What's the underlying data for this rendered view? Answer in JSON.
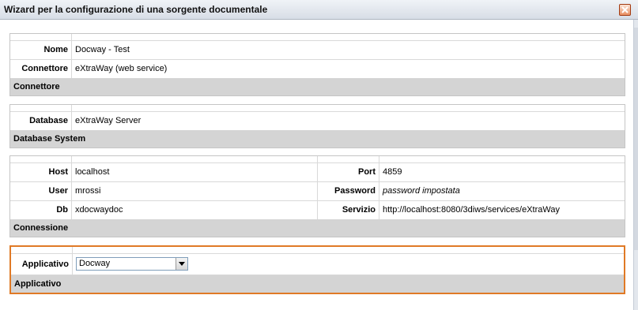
{
  "window": {
    "title": "Wizard per la configurazione di una sorgente documentale"
  },
  "connettore_section": {
    "footer": "Connettore",
    "rows": [
      {
        "label": "Nome",
        "value": "Docway - Test"
      },
      {
        "label": "Connettore",
        "value": "eXtraWay (web service)"
      }
    ]
  },
  "database_section": {
    "footer": "Database System",
    "rows": [
      {
        "label": "Database",
        "value": "eXtraWay Server"
      }
    ]
  },
  "connessione_section": {
    "footer": "Connessione",
    "rows": [
      {
        "label": "Host",
        "value": "localhost",
        "label2": "Port",
        "value2": "4859"
      },
      {
        "label": "User",
        "value": "mrossi",
        "label2": "Password",
        "value2": "password impostata"
      },
      {
        "label": "Db",
        "value": "xdocwaydoc",
        "label2": "Servizio",
        "value2": "http://localhost:8080/3diws/services/eXtraWay"
      }
    ]
  },
  "applicativo_section": {
    "footer": "Applicativo",
    "label": "Applicativo",
    "selected": "Docway"
  },
  "icons": {
    "close": "close-icon",
    "dropdown": "chevron-down-icon"
  },
  "colors": {
    "highlight_border": "#e07a26",
    "section_footer_bg": "#d4d4d4",
    "close_button": "#e98f62"
  }
}
